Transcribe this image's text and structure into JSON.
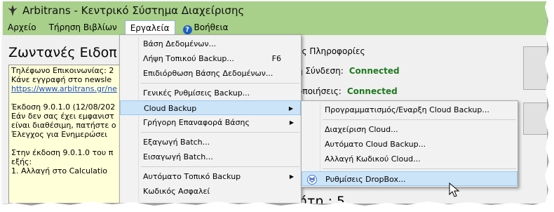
{
  "window": {
    "title": "Arbitrans - Κεντρικό Σύστημα Διαχείρισης"
  },
  "menubar": {
    "items": [
      "Αρχείο",
      "Τήρηση Βιβλίων",
      "Εργαλεία",
      "Βοήθεια"
    ]
  },
  "news": {
    "title": "Ζωντανές Ειδοπ",
    "lines": [
      "Τηλέφωνο Επικοινωνίας: 2",
      "Κάνε εγγραφή στο newsle",
      "https://www.arbitrans.gr/ne",
      "",
      "Έκδοση 9.0.1.0 (12/08/202",
      "Εάν δεν σας έχει εμφανιστ",
      "είναι διαθέσιμη, πατήστε ο",
      "Έλεγχος για Ενημερώσει",
      "",
      "Στην έκδοση 9.0.1.0 του π",
      "εξής:",
      "1. Αλλαγή στο Calculatio"
    ]
  },
  "info": {
    "group_label": "ές Πληροφορίες",
    "rows": [
      {
        "label": "ή Σύνδεση:",
        "status": "Connected"
      },
      {
        "label": "οποιήσεις:",
        "status": "Connected"
      }
    ],
    "count_text": "ήτη : 5"
  },
  "tools_menu": {
    "items": [
      {
        "label": "Βάση Δεδομένων..."
      },
      {
        "label": "Λήψη Τοπικού Backup...",
        "shortcut": "F6"
      },
      {
        "label": "Επιδιόρθωση Βάσης Δεδομένων..."
      },
      {
        "label": "Γενικές Ρυθμίσεις Backup..."
      },
      {
        "label": "Cloud Backup"
      },
      {
        "label": "Γρήγορη Επαναφορά Βάσης"
      },
      {
        "label": "Εξαγωγή Batch..."
      },
      {
        "label": "Εισαγωγή Batch..."
      },
      {
        "label": "Αυτόματο Τοπικό Backup"
      },
      {
        "label": "Κωδικός Ασφαλεί"
      }
    ]
  },
  "cloud_menu": {
    "items": [
      {
        "label": "Προγραμματισμός/Εναρξη Cloud Backup..."
      },
      {
        "label": "Διαχείριση Cloud..."
      },
      {
        "label": "Αυτόματο Cloud Backup..."
      },
      {
        "label": "Αλλαγή Κωδικού Cloud..."
      },
      {
        "label": "Ρυθμίσεις DropBox..."
      }
    ]
  },
  "colors": {
    "titlebar": "#a8d08a",
    "connected": "#1e7a1e",
    "highlight": "#cce4f7"
  }
}
